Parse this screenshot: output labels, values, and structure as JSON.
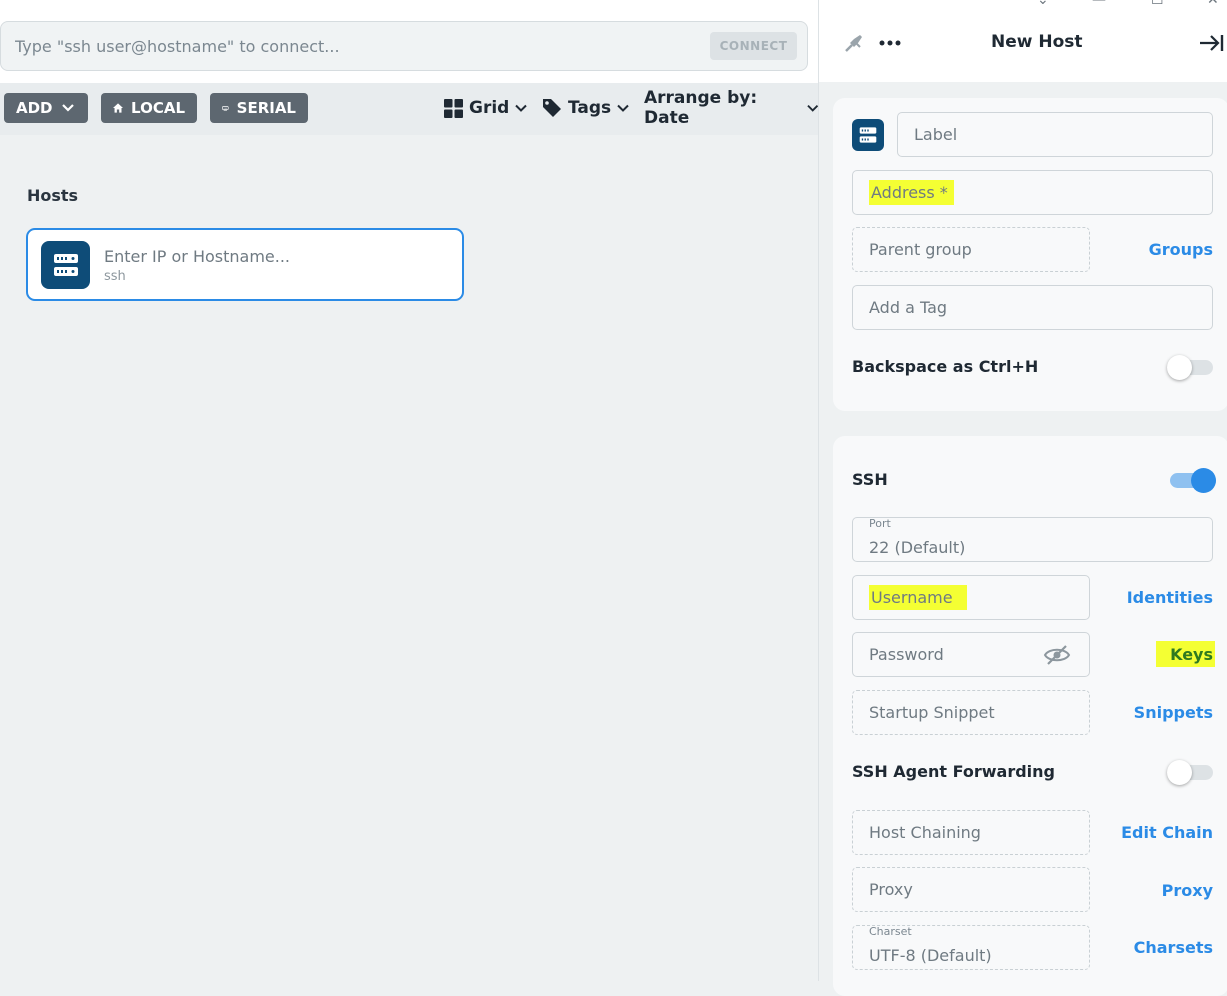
{
  "window": {
    "chevron": "⌄",
    "minimize": "—",
    "maximize": "☐",
    "close": "✕"
  },
  "connect": {
    "placeholder": "Type \"ssh user@hostname\" to connect...",
    "button": "CONNECT"
  },
  "toolbar": {
    "add": "ADD",
    "local": "LOCAL",
    "serial": "SERIAL",
    "grid": "Grid",
    "tags": "Tags",
    "arrange": "Arrange by: Date"
  },
  "hosts": {
    "title": "Hosts",
    "card": {
      "placeholder": "Enter IP or Hostname...",
      "protocol": "ssh"
    }
  },
  "panel": {
    "title": "New Host",
    "label_placeholder": "Label",
    "address_placeholder": "Address *",
    "parent_group": "Parent group",
    "groups_link": "Groups",
    "tag_placeholder": "Add a Tag",
    "backspace_label": "Backspace as Ctrl+H",
    "backspace_on": false,
    "ssh_label": "SSH",
    "ssh_on": true,
    "port_label": "Port",
    "port_value": "22 (Default)",
    "username_placeholder": "Username",
    "identities_link": "Identities",
    "password_placeholder": "Password",
    "keys_link": "Keys",
    "startup_snippet": "Startup Snippet",
    "snippets_link": "Snippets",
    "agent_forwarding_label": "SSH Agent Forwarding",
    "agent_forwarding_on": false,
    "host_chaining": "Host Chaining",
    "edit_chain_link": "Edit Chain",
    "proxy": "Proxy",
    "proxy_link": "Proxy",
    "charset_label": "Charset",
    "charset_value": "UTF-8 (Default)",
    "charsets_link": "Charsets"
  },
  "colors": {
    "accent": "#2b8be6",
    "host_icon_bg": "#0e4c78",
    "highlight": "#f4ff33",
    "toolbar_button": "#5d6770"
  }
}
